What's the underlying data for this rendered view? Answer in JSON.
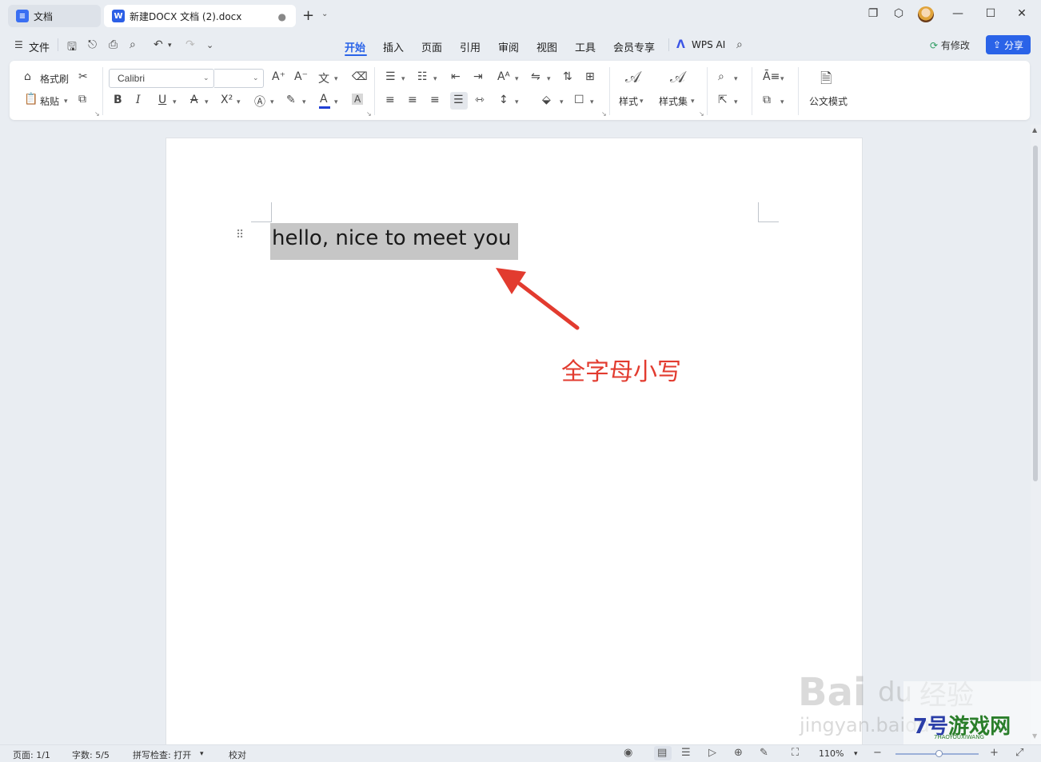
{
  "titlebar": {
    "home_tab": "文档",
    "doc_tab": "新建DOCX 文档 (2).docx",
    "doc_tab_modified_dot": "●",
    "new_tab_plus": "+",
    "new_tab_arrow": "⌄"
  },
  "menubar": {
    "file": "文件",
    "tabs": [
      "开始",
      "插入",
      "页面",
      "引用",
      "审阅",
      "视图",
      "工具",
      "会员专享"
    ],
    "active_tab": "开始",
    "wps_ai": "WPS AI",
    "modified": "有修改",
    "share": "分享"
  },
  "ribbon": {
    "format_painter": "格式刷",
    "paste": "粘贴",
    "font_name": "Calibri",
    "font_size": "",
    "styles": "样式",
    "style_set": "样式集",
    "official_mode": "公文模式"
  },
  "document": {
    "text": "hello, nice to meet you",
    "annotation": "全字母小写"
  },
  "watermark": {
    "baidu": "Bai",
    "du": "du",
    "jingyan": "经验",
    "domain": "jingyan.baidu",
    "site_logo": "7号游戏网",
    "site_sub": "7HAOYOUXIWANG"
  },
  "statusbar": {
    "page": "页面: 1/1",
    "word_count": "字数: 5/5",
    "spell_check": "拼写检查: 打开",
    "proofread": "校对",
    "zoom": "110%"
  },
  "colors": {
    "accent": "#2a63e8",
    "annotation": "#e23b2f",
    "selection": "#c6c6c6"
  }
}
